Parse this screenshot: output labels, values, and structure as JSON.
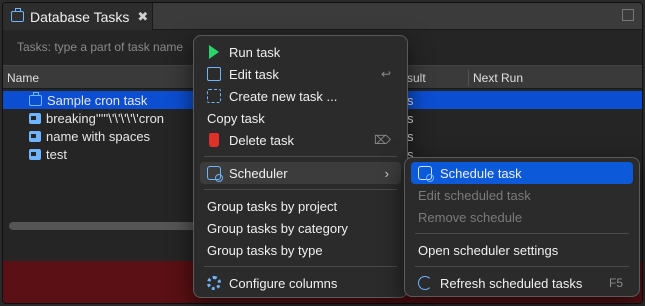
{
  "tab": {
    "title": "Database Tasks",
    "close": "✖"
  },
  "filter": {
    "placeholder": "Tasks: type a part of task name"
  },
  "columns": {
    "name": "Name",
    "last_result": "sult",
    "next_run": "Next Run"
  },
  "rows": [
    {
      "name": "Sample cron task",
      "result": "s",
      "icon": "cron-icon"
    },
    {
      "name": "breaking'''''\\'\\'\\'\\'\\'cron",
      "result": "s",
      "icon": "shell-icon"
    },
    {
      "name": "name with spaces",
      "result": "s",
      "icon": "shell-icon"
    },
    {
      "name": "test",
      "result": "s",
      "icon": "shell-icon"
    }
  ],
  "context_menu": {
    "run_task": "Run task",
    "edit_task": "Edit task",
    "edit_shortcut": "↩",
    "create_task": "Create new task ...",
    "copy_task": "Copy task",
    "delete_task": "Delete task",
    "delete_shortcut": "⌦",
    "scheduler": "Scheduler",
    "scheduler_arrow": "›",
    "group_project": "Group tasks by project",
    "group_category": "Group tasks by category",
    "group_type": "Group tasks by type",
    "configure_columns": "Configure columns"
  },
  "scheduler_menu": {
    "schedule_task": "Schedule task",
    "edit_scheduled": "Edit scheduled task",
    "remove_schedule": "Remove schedule",
    "open_settings": "Open scheduler settings",
    "refresh": "Refresh scheduled tasks",
    "refresh_shortcut": "F5"
  },
  "colors": {
    "selection": "#0c4ed1",
    "menu_highlight": "#0c5ad9",
    "accent_icon": "#6fb4ff",
    "run_icon": "#2bd46a",
    "delete_icon": "#e0302a"
  }
}
